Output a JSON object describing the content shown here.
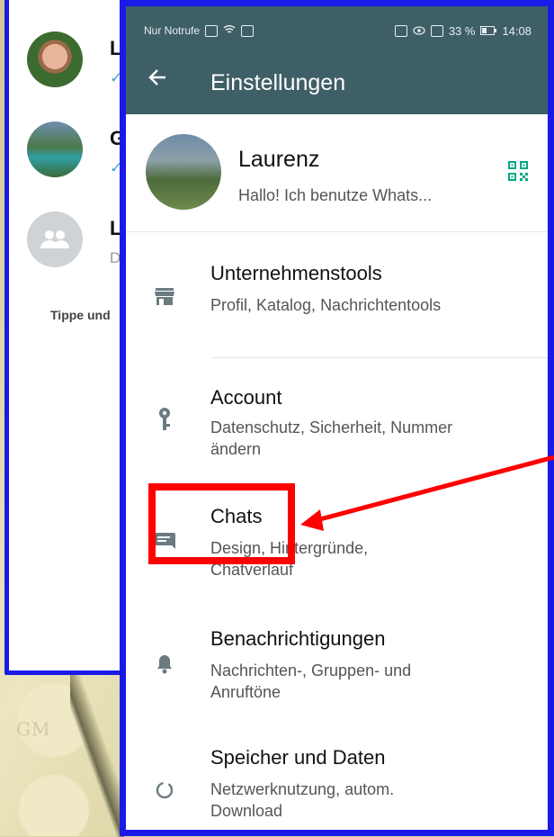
{
  "background": {
    "logo_text": "GM"
  },
  "back_panel": {
    "chats": [
      {
        "name": "La",
        "subtitle": "✓✓"
      },
      {
        "name": "G",
        "subtitle": "✓✓"
      },
      {
        "name": "La",
        "subtitle": "Dr"
      }
    ],
    "tip": "Tippe und"
  },
  "status_bar": {
    "left_text": "Nur Notrufe",
    "battery": "33 %",
    "time": "14:08"
  },
  "app_bar": {
    "title": "Einstellungen",
    "back_icon": "arrow-back-icon"
  },
  "profile": {
    "name": "Laurenz",
    "status": "Hallo! Ich benutze Whats...",
    "qr_icon": "qr-code-icon"
  },
  "settings": [
    {
      "title": "Unternehmenstools",
      "subtitle": "Profil, Katalog, Nachrichtentools",
      "icon": "store-icon"
    },
    {
      "title": "Account",
      "subtitle": "Datenschutz, Sicherheit, Nummer ändern",
      "icon": "key-icon"
    },
    {
      "title": "Chats",
      "subtitle": "Design, Hintergründe, Chatverlauf",
      "icon": "chat-icon"
    },
    {
      "title": "Benachrichtigungen",
      "subtitle": "Nachrichten-, Gruppen- und Anruftöne",
      "icon": "bell-icon"
    },
    {
      "title": "Speicher und Daten",
      "subtitle": "Netzwerknutzung, autom. Download",
      "icon": "data-usage-icon"
    }
  ],
  "colors": {
    "header": "#3f5f67",
    "accent": "#00a884",
    "annotation": "#ff0000",
    "frame": "#1a1ae6"
  }
}
